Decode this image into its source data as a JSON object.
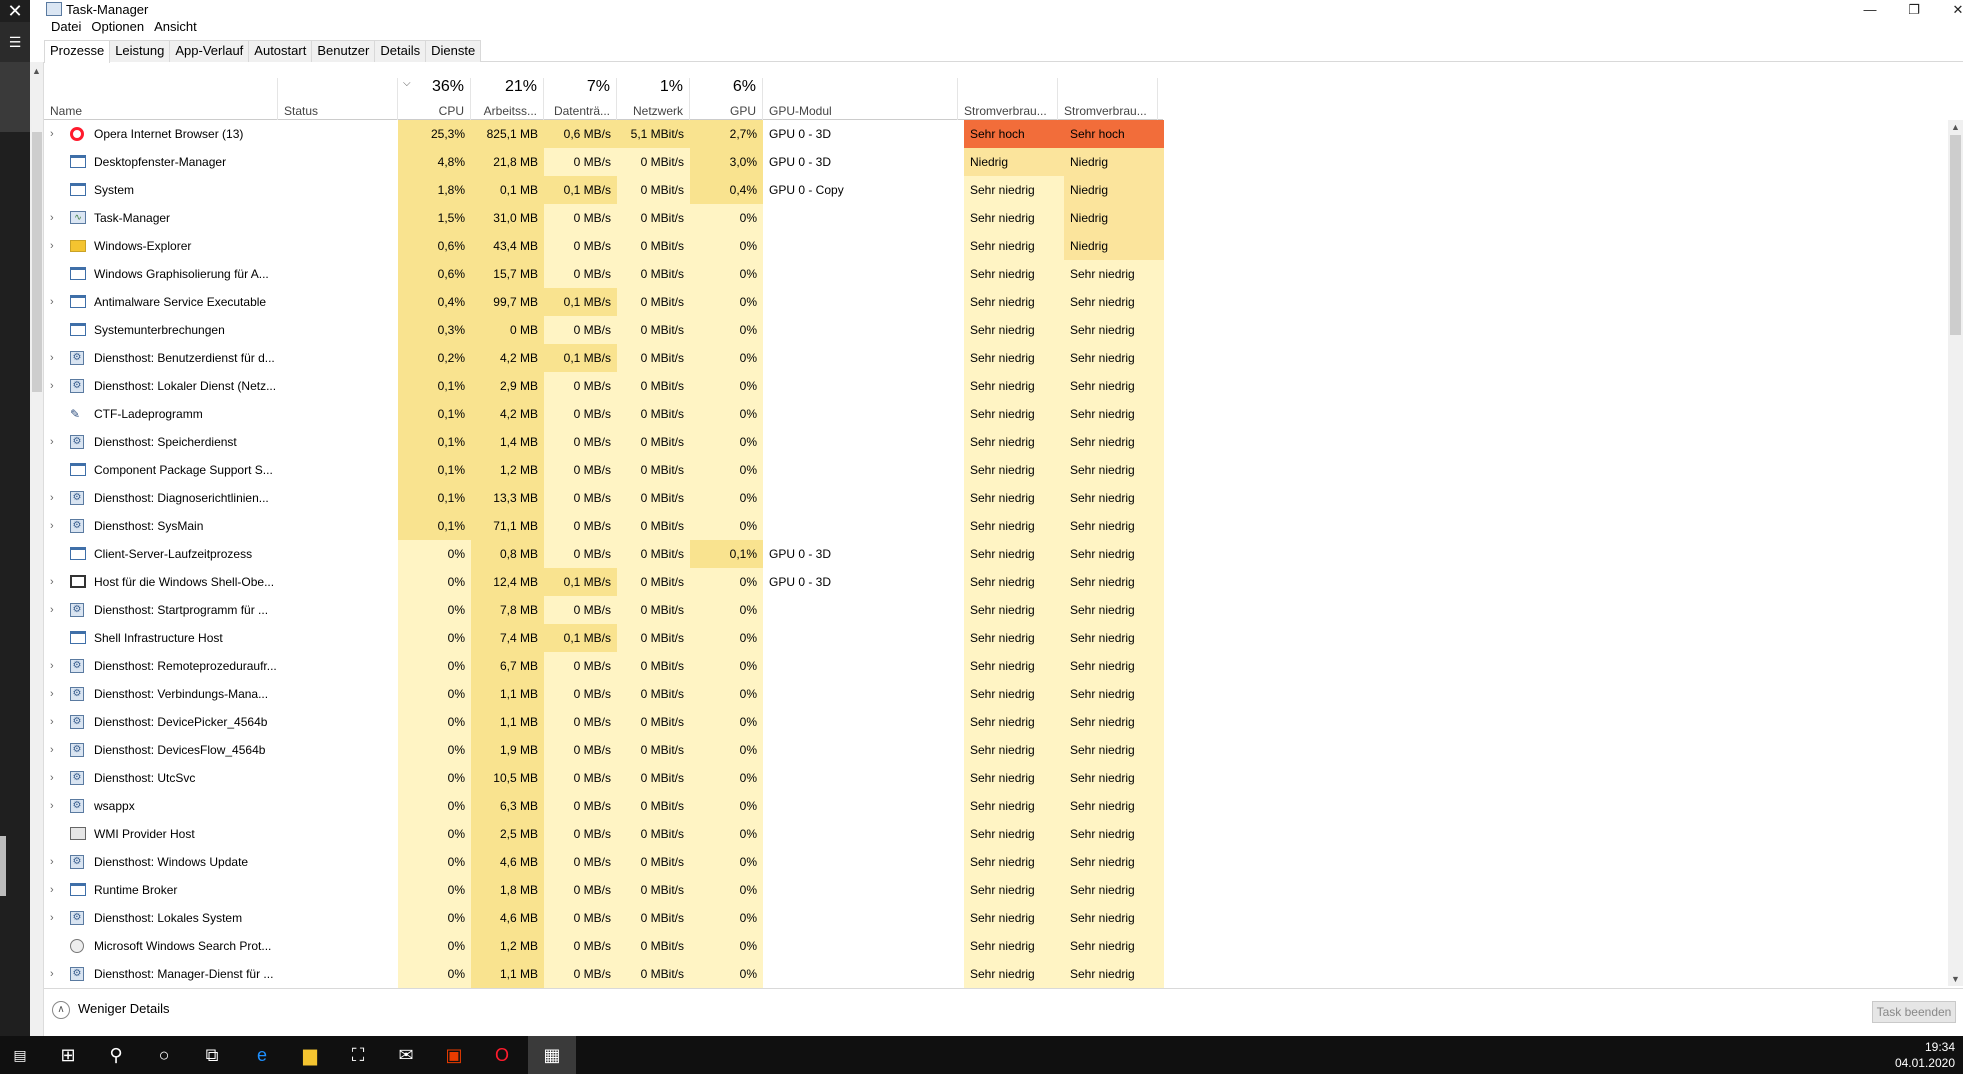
{
  "window": {
    "title": "Task-Manager"
  },
  "menu": [
    "Datei",
    "Optionen",
    "Ansicht"
  ],
  "tabs": [
    "Prozesse",
    "Leistung",
    "App-Verlauf",
    "Autostart",
    "Benutzer",
    "Details",
    "Dienste"
  ],
  "columns": {
    "name": "Name",
    "status": "Status",
    "cpu_pct": "36%",
    "cpu": "CPU",
    "mem_pct": "21%",
    "mem": "Arbeitss...",
    "disk_pct": "7%",
    "disk": "Datenträ...",
    "net_pct": "1%",
    "net": "Netzwerk",
    "gpu_pct": "6%",
    "gpu": "GPU",
    "gpumod": "GPU-Modul",
    "power": "Stromverbrau...",
    "power2": "Stromverbrau..."
  },
  "rows": [
    {
      "name": "Opera Internet Browser (13)",
      "exp": true,
      "icon": "opera-icon",
      "cpu": "25,3%",
      "mem": "825,1 MB",
      "disk": "0,6 MB/s",
      "net": "5,1 MBit/s",
      "gpu": "2,7%",
      "gmod": "GPU 0 - 3D",
      "p1": "Sehr hoch",
      "p2": "Sehr hoch"
    },
    {
      "name": "Desktopfenster-Manager",
      "exp": false,
      "icon": "window-icon",
      "cpu": "4,8%",
      "mem": "21,8 MB",
      "disk": "0 MB/s",
      "net": "0 MBit/s",
      "gpu": "3,0%",
      "gmod": "GPU 0 - 3D",
      "p1": "Niedrig",
      "p2": "Niedrig"
    },
    {
      "name": "System",
      "exp": false,
      "icon": "window-icon",
      "cpu": "1,8%",
      "mem": "0,1 MB",
      "disk": "0,1 MB/s",
      "net": "0 MBit/s",
      "gpu": "0,4%",
      "gmod": "GPU 0 - Copy",
      "p1": "Sehr niedrig",
      "p2": "Niedrig"
    },
    {
      "name": "Task-Manager",
      "exp": true,
      "icon": "task-manager-icon",
      "cpu": "1,5%",
      "mem": "31,0 MB",
      "disk": "0 MB/s",
      "net": "0 MBit/s",
      "gpu": "0%",
      "gmod": "",
      "p1": "Sehr niedrig",
      "p2": "Niedrig"
    },
    {
      "name": "Windows-Explorer",
      "exp": true,
      "icon": "folder-icon",
      "cpu": "0,6%",
      "mem": "43,4 MB",
      "disk": "0 MB/s",
      "net": "0 MBit/s",
      "gpu": "0%",
      "gmod": "",
      "p1": "Sehr niedrig",
      "p2": "Niedrig"
    },
    {
      "name": "Windows Graphisolierung für A...",
      "exp": false,
      "icon": "window-icon",
      "cpu": "0,6%",
      "mem": "15,7 MB",
      "disk": "0 MB/s",
      "net": "0 MBit/s",
      "gpu": "0%",
      "gmod": "",
      "p1": "Sehr niedrig",
      "p2": "Sehr niedrig"
    },
    {
      "name": "Antimalware Service Executable",
      "exp": true,
      "icon": "window-icon",
      "cpu": "0,4%",
      "mem": "99,7 MB",
      "disk": "0,1 MB/s",
      "net": "0 MBit/s",
      "gpu": "0%",
      "gmod": "",
      "p1": "Sehr niedrig",
      "p2": "Sehr niedrig"
    },
    {
      "name": "Systemunterbrechungen",
      "exp": false,
      "icon": "window-icon",
      "cpu": "0,3%",
      "mem": "0 MB",
      "disk": "0 MB/s",
      "net": "0 MBit/s",
      "gpu": "0%",
      "gmod": "",
      "p1": "Sehr niedrig",
      "p2": "Sehr niedrig"
    },
    {
      "name": "Diensthost: Benutzerdienst für d...",
      "exp": true,
      "icon": "gear-icon",
      "cpu": "0,2%",
      "mem": "4,2 MB",
      "disk": "0,1 MB/s",
      "net": "0 MBit/s",
      "gpu": "0%",
      "gmod": "",
      "p1": "Sehr niedrig",
      "p2": "Sehr niedrig"
    },
    {
      "name": "Diensthost: Lokaler Dienst (Netz...",
      "exp": true,
      "icon": "gear-icon",
      "cpu": "0,1%",
      "mem": "2,9 MB",
      "disk": "0 MB/s",
      "net": "0 MBit/s",
      "gpu": "0%",
      "gmod": "",
      "p1": "Sehr niedrig",
      "p2": "Sehr niedrig"
    },
    {
      "name": "CTF-Ladeprogramm",
      "exp": false,
      "icon": "pen-icon",
      "cpu": "0,1%",
      "mem": "4,2 MB",
      "disk": "0 MB/s",
      "net": "0 MBit/s",
      "gpu": "0%",
      "gmod": "",
      "p1": "Sehr niedrig",
      "p2": "Sehr niedrig"
    },
    {
      "name": "Diensthost: Speicherdienst",
      "exp": true,
      "icon": "gear-icon",
      "cpu": "0,1%",
      "mem": "1,4 MB",
      "disk": "0 MB/s",
      "net": "0 MBit/s",
      "gpu": "0%",
      "gmod": "",
      "p1": "Sehr niedrig",
      "p2": "Sehr niedrig"
    },
    {
      "name": "Component Package Support S...",
      "exp": false,
      "icon": "window-icon",
      "cpu": "0,1%",
      "mem": "1,2 MB",
      "disk": "0 MB/s",
      "net": "0 MBit/s",
      "gpu": "0%",
      "gmod": "",
      "p1": "Sehr niedrig",
      "p2": "Sehr niedrig"
    },
    {
      "name": "Diensthost: Diagnoserichtlinien...",
      "exp": true,
      "icon": "gear-icon",
      "cpu": "0,1%",
      "mem": "13,3 MB",
      "disk": "0 MB/s",
      "net": "0 MBit/s",
      "gpu": "0%",
      "gmod": "",
      "p1": "Sehr niedrig",
      "p2": "Sehr niedrig"
    },
    {
      "name": "Diensthost: SysMain",
      "exp": true,
      "icon": "gear-icon",
      "cpu": "0,1%",
      "mem": "71,1 MB",
      "disk": "0 MB/s",
      "net": "0 MBit/s",
      "gpu": "0%",
      "gmod": "",
      "p1": "Sehr niedrig",
      "p2": "Sehr niedrig"
    },
    {
      "name": "Client-Server-Laufzeitprozess",
      "exp": false,
      "icon": "window-icon",
      "cpu": "0%",
      "mem": "0,8 MB",
      "disk": "0 MB/s",
      "net": "0 MBit/s",
      "gpu": "0,1%",
      "gmod": "GPU 0 - 3D",
      "p1": "Sehr niedrig",
      "p2": "Sehr niedrig"
    },
    {
      "name": "Host für die Windows Shell-Obe...",
      "exp": true,
      "icon": "shell-icon",
      "cpu": "0%",
      "mem": "12,4 MB",
      "disk": "0,1 MB/s",
      "net": "0 MBit/s",
      "gpu": "0%",
      "gmod": "GPU 0 - 3D",
      "p1": "Sehr niedrig",
      "p2": "Sehr niedrig"
    },
    {
      "name": "Diensthost: Startprogramm für ...",
      "exp": true,
      "icon": "gear-icon",
      "cpu": "0%",
      "mem": "7,8 MB",
      "disk": "0 MB/s",
      "net": "0 MBit/s",
      "gpu": "0%",
      "gmod": "",
      "p1": "Sehr niedrig",
      "p2": "Sehr niedrig"
    },
    {
      "name": "Shell Infrastructure Host",
      "exp": false,
      "icon": "window-icon",
      "cpu": "0%",
      "mem": "7,4 MB",
      "disk": "0,1 MB/s",
      "net": "0 MBit/s",
      "gpu": "0%",
      "gmod": "",
      "p1": "Sehr niedrig",
      "p2": "Sehr niedrig"
    },
    {
      "name": "Diensthost: Remoteprozeduraufr...",
      "exp": true,
      "icon": "gear-icon",
      "cpu": "0%",
      "mem": "6,7 MB",
      "disk": "0 MB/s",
      "net": "0 MBit/s",
      "gpu": "0%",
      "gmod": "",
      "p1": "Sehr niedrig",
      "p2": "Sehr niedrig"
    },
    {
      "name": "Diensthost: Verbindungs-Mana...",
      "exp": true,
      "icon": "gear-icon",
      "cpu": "0%",
      "mem": "1,1 MB",
      "disk": "0 MB/s",
      "net": "0 MBit/s",
      "gpu": "0%",
      "gmod": "",
      "p1": "Sehr niedrig",
      "p2": "Sehr niedrig"
    },
    {
      "name": "Diensthost: DevicePicker_4564b",
      "exp": true,
      "icon": "gear-icon",
      "cpu": "0%",
      "mem": "1,1 MB",
      "disk": "0 MB/s",
      "net": "0 MBit/s",
      "gpu": "0%",
      "gmod": "",
      "p1": "Sehr niedrig",
      "p2": "Sehr niedrig"
    },
    {
      "name": "Diensthost: DevicesFlow_4564b",
      "exp": true,
      "icon": "gear-icon",
      "cpu": "0%",
      "mem": "1,9 MB",
      "disk": "0 MB/s",
      "net": "0 MBit/s",
      "gpu": "0%",
      "gmod": "",
      "p1": "Sehr niedrig",
      "p2": "Sehr niedrig"
    },
    {
      "name": "Diensthost: UtcSvc",
      "exp": true,
      "icon": "gear-icon",
      "cpu": "0%",
      "mem": "10,5 MB",
      "disk": "0 MB/s",
      "net": "0 MBit/s",
      "gpu": "0%",
      "gmod": "",
      "p1": "Sehr niedrig",
      "p2": "Sehr niedrig"
    },
    {
      "name": "wsappx",
      "exp": true,
      "icon": "gear-icon",
      "cpu": "0%",
      "mem": "6,3 MB",
      "disk": "0 MB/s",
      "net": "0 MBit/s",
      "gpu": "0%",
      "gmod": "",
      "p1": "Sehr niedrig",
      "p2": "Sehr niedrig"
    },
    {
      "name": "WMI Provider Host",
      "exp": false,
      "icon": "wmi-icon",
      "cpu": "0%",
      "mem": "2,5 MB",
      "disk": "0 MB/s",
      "net": "0 MBit/s",
      "gpu": "0%",
      "gmod": "",
      "p1": "Sehr niedrig",
      "p2": "Sehr niedrig"
    },
    {
      "name": "Diensthost: Windows Update",
      "exp": true,
      "icon": "gear-icon",
      "cpu": "0%",
      "mem": "4,6 MB",
      "disk": "0 MB/s",
      "net": "0 MBit/s",
      "gpu": "0%",
      "gmod": "",
      "p1": "Sehr niedrig",
      "p2": "Sehr niedrig"
    },
    {
      "name": "Runtime Broker",
      "exp": true,
      "icon": "window-icon",
      "cpu": "0%",
      "mem": "1,8 MB",
      "disk": "0 MB/s",
      "net": "0 MBit/s",
      "gpu": "0%",
      "gmod": "",
      "p1": "Sehr niedrig",
      "p2": "Sehr niedrig"
    },
    {
      "name": "Diensthost: Lokales System",
      "exp": true,
      "icon": "gear-icon",
      "cpu": "0%",
      "mem": "4,6 MB",
      "disk": "0 MB/s",
      "net": "0 MBit/s",
      "gpu": "0%",
      "gmod": "",
      "p1": "Sehr niedrig",
      "p2": "Sehr niedrig"
    },
    {
      "name": "Microsoft Windows Search Prot...",
      "exp": false,
      "icon": "search-person-icon",
      "cpu": "0%",
      "mem": "1,2 MB",
      "disk": "0 MB/s",
      "net": "0 MBit/s",
      "gpu": "0%",
      "gmod": "",
      "p1": "Sehr niedrig",
      "p2": "Sehr niedrig"
    },
    {
      "name": "Diensthost: Manager-Dienst für ...",
      "exp": true,
      "icon": "gear-icon",
      "cpu": "0%",
      "mem": "1,1 MB",
      "disk": "0 MB/s",
      "net": "0 MBit/s",
      "gpu": "0%",
      "gmod": "",
      "p1": "Sehr niedrig",
      "p2": "Sehr niedrig"
    }
  ],
  "footer": {
    "less_details": "Weniger Details",
    "end_task": "Task beenden"
  },
  "taskbar": {
    "time": "19:34",
    "date": "04.01.2020"
  },
  "colors": {
    "heat_high": "#f9e38f",
    "heat_low": "#fff4c4",
    "power_very_high": "#f26d3a",
    "power_low": "#fbe49c"
  }
}
